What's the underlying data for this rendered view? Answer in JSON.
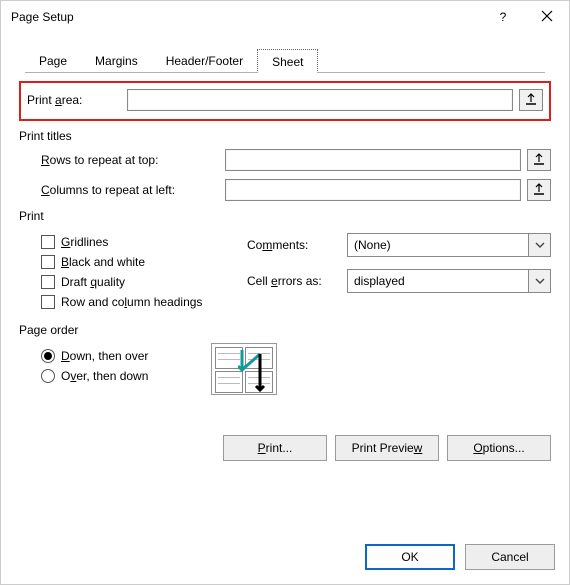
{
  "titlebar": {
    "title": "Page Setup",
    "help_tooltip": "?",
    "close_tooltip": "Close"
  },
  "tabs": {
    "page": "Page",
    "margins": "Margins",
    "headerfooter": "Header/Footer",
    "sheet": "Sheet"
  },
  "print_area": {
    "label_pre": "Print ",
    "label_ul": "a",
    "label_post": "rea:",
    "value": ""
  },
  "print_titles": {
    "group": "Print titles",
    "rows_ul": "R",
    "rows_post": "ows to repeat at top:",
    "rows_value": "",
    "cols_ul": "C",
    "cols_post": "olumns to repeat at left:",
    "cols_value": ""
  },
  "print": {
    "group": "Print",
    "gridlines_ul": "G",
    "gridlines_post": "ridlines",
    "bw_ul": "B",
    "bw_post": "lack and white",
    "draft_pre": "Draft ",
    "draft_ul": "q",
    "draft_post": "uality",
    "rch_pre": "Row and co",
    "rch_ul": "l",
    "rch_post": "umn headings",
    "comments_label_pre": "Co",
    "comments_label_ul": "m",
    "comments_label_post": "ments:",
    "comments_value": "(None)",
    "cellerr_label_pre": "Cell ",
    "cellerr_label_ul": "e",
    "cellerr_label_post": "rrors as:",
    "cellerr_value": "displayed"
  },
  "page_order": {
    "group": "Page order",
    "down_ul": "D",
    "down_post": "own, then over",
    "over_pre": "O",
    "over_ul": "v",
    "over_post": "er, then down"
  },
  "buttons": {
    "print_ul": "P",
    "print_post": "rint...",
    "preview_pre": "Print Previe",
    "preview_ul": "w",
    "options_ul": "O",
    "options_post": "ptions...",
    "ok": "OK",
    "cancel": "Cancel"
  }
}
